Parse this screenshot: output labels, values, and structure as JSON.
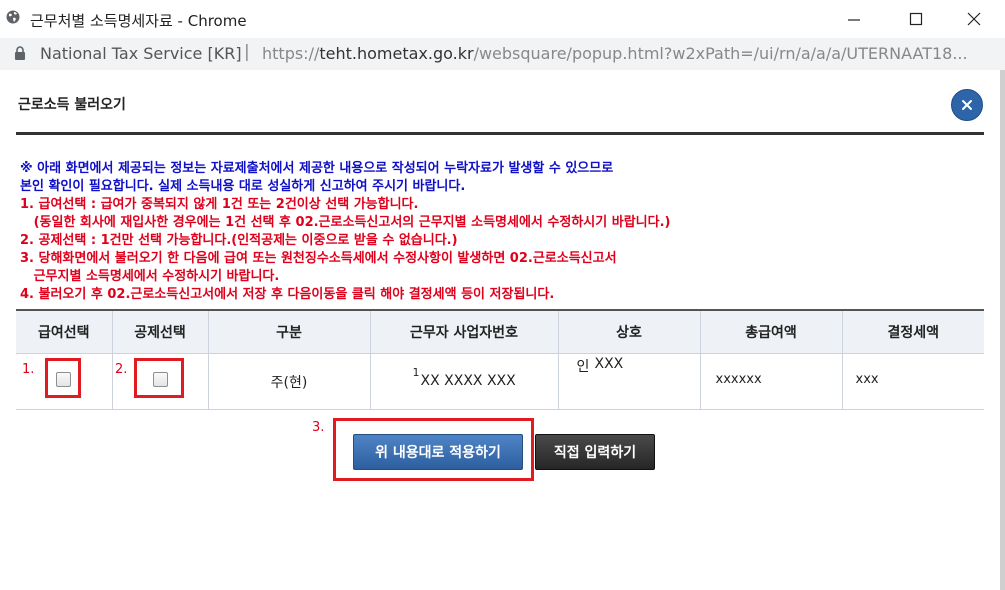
{
  "window": {
    "title": "근무처별 소득명세자료 - Chrome"
  },
  "address_bar": {
    "site": "National Tax Service [KR]",
    "separator": "|",
    "url_scheme": "https://",
    "url_host": "teht.hometax.go.kr",
    "url_path": "/websquare/popup.html?w2xPath=/ui/rn/a/a/a/UTERNAAT18..."
  },
  "popup": {
    "title": "근로소득 불러오기",
    "close_icon": "close-icon"
  },
  "notice": {
    "lines": [
      {
        "text": "※ 아래 화면에서 제공되는 정보는 자료제출처에서 제공한 내용으로 작성되어 누락자료가 발생할 수 있으므로",
        "color": "#1010c8"
      },
      {
        "text": "본인 확인이 필요합니다. 실제 소득내용 대로 성실하게 신고하여 주시기 바랍니다.",
        "color": "#1010c8"
      },
      {
        "text": "1. 급여선택 : 급여가 중복되지 않게 1건 또는 2건이상 선택 가능합니다.",
        "color": "#e0001c"
      },
      {
        "text": "   (동일한 회사에 재입사한 경우에는 1건 선택 후 02.근로소득신고서의 근무지별 소득명세에서 수정하시기 바랍니다.)",
        "color": "#e0001c"
      },
      {
        "text": "2. 공제선택 : 1건만 선택 가능합니다.(인적공제는 이중으로 받을 수 없습니다.)",
        "color": "#e0001c"
      },
      {
        "text": "3. 당해화면에서 불러오기 한 다음에 급여 또는 원천징수소득세에서 수정사항이 발생하면 02.근로소득신고서",
        "color": "#e0001c"
      },
      {
        "text": "   근무지별 소득명세에서 수정하시기 바랍니다.",
        "color": "#e0001c"
      },
      {
        "text": "4. 불러오기 후 02.근로소득신고서에서 저장 후 다음이동을 클릭 해야 결정세액 등이 저장됩니다.",
        "color": "#e0001c"
      }
    ]
  },
  "table": {
    "headers": [
      "급여선택",
      "공제선택",
      "구분",
      "근무자 사업자번호",
      "상호",
      "총급여액",
      "결정세액"
    ],
    "row": {
      "salary_checked": false,
      "deduction_checked": false,
      "category": "주(현)",
      "biz_number_prefix": "1",
      "biz_number": "XX XXXX XXX",
      "company_prefix": "인",
      "company": "XXX",
      "total_salary": "xxxxxx",
      "tax": "xxx"
    }
  },
  "annotations": {
    "n1": "1.",
    "n2": "2.",
    "n3": "3.",
    "highlight_color": "#e21b22"
  },
  "buttons": {
    "apply": "위 내용대로 적용하기",
    "direct": "직접 입력하기"
  }
}
